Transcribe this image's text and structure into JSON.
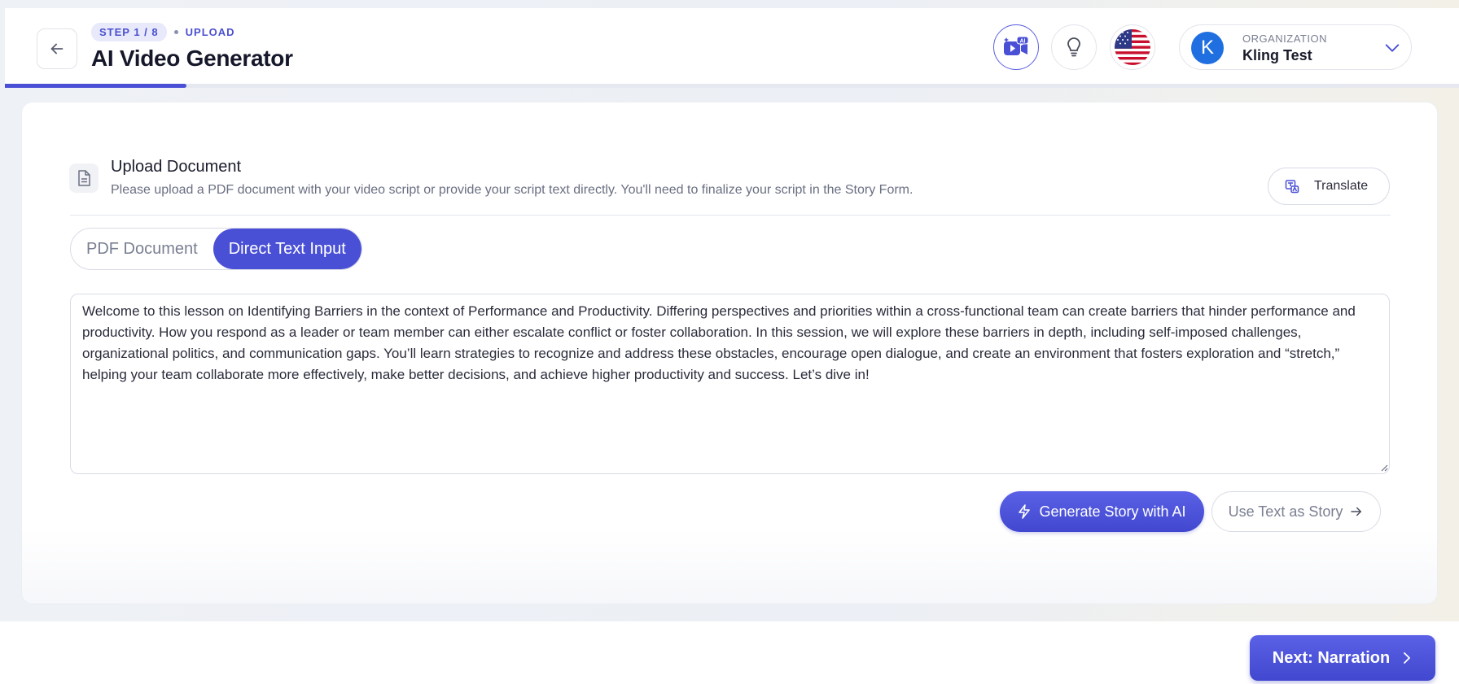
{
  "header": {
    "step_label": "STEP 1 / 8",
    "step_name": "UPLOAD",
    "title": "AI Video Generator",
    "progress": 0.125,
    "icons": [
      "ai-video-icon",
      "lightbulb-icon",
      "us-flag-icon"
    ],
    "org": {
      "label": "ORGANIZATION",
      "name": "Kling Test",
      "avatar_letter": "K"
    }
  },
  "upload": {
    "title": "Upload Document",
    "description": "Please upload a PDF document with your video script or provide your script text directly. You'll need to finalize your script in the Story Form.",
    "translate_label": "Translate"
  },
  "tabs": [
    {
      "label": "PDF Document",
      "active": false
    },
    {
      "label": "Direct Text Input",
      "active": true
    }
  ],
  "script_text": "Welcome to this lesson on Identifying Barriers in the context of Performance and Productivity. Differing perspectives and priorities within a cross-functional team can create barriers that hinder performance and productivity. How you respond as a leader or team member can either escalate conflict or foster collaboration. In this session, we will explore these barriers in depth, including self-imposed challenges, organizational politics, and communication gaps. You’ll learn strategies to recognize and address these obstacles, encourage open dialogue, and create an environment that fosters exploration and “stretch,” helping your team collaborate more effectively, make better decisions, and achieve higher productivity and success. Let’s dive in!",
  "actions": {
    "generate_label": "Generate Story with AI",
    "use_text_label": "Use Text as Story"
  },
  "footer": {
    "next_label": "Next: Narration"
  },
  "colors": {
    "accent": "#4a50d6",
    "org_avatar": "#1f6fe0"
  }
}
